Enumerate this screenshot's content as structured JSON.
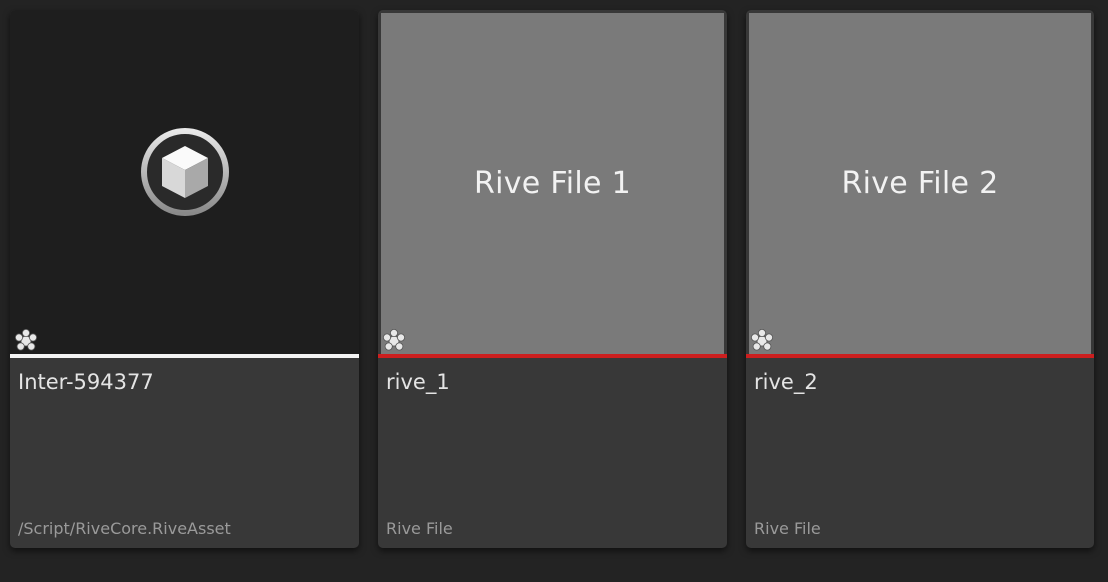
{
  "assets": [
    {
      "name": "Inter-594377",
      "type": "/Script/RiveCore.RiveAsset",
      "thumbnail_text": "",
      "thumbnail_icon": "cube-icon",
      "bar_color": "#f4f4f4"
    },
    {
      "name": "rive_1",
      "type": "Rive File",
      "thumbnail_text": "Rive File 1",
      "bar_color": "#cc1f1f"
    },
    {
      "name": "rive_2",
      "type": "Rive File",
      "thumbnail_text": "Rive File 2",
      "bar_color": "#cc1f1f"
    }
  ],
  "overlay_icon": "asterisk-badge-icon"
}
